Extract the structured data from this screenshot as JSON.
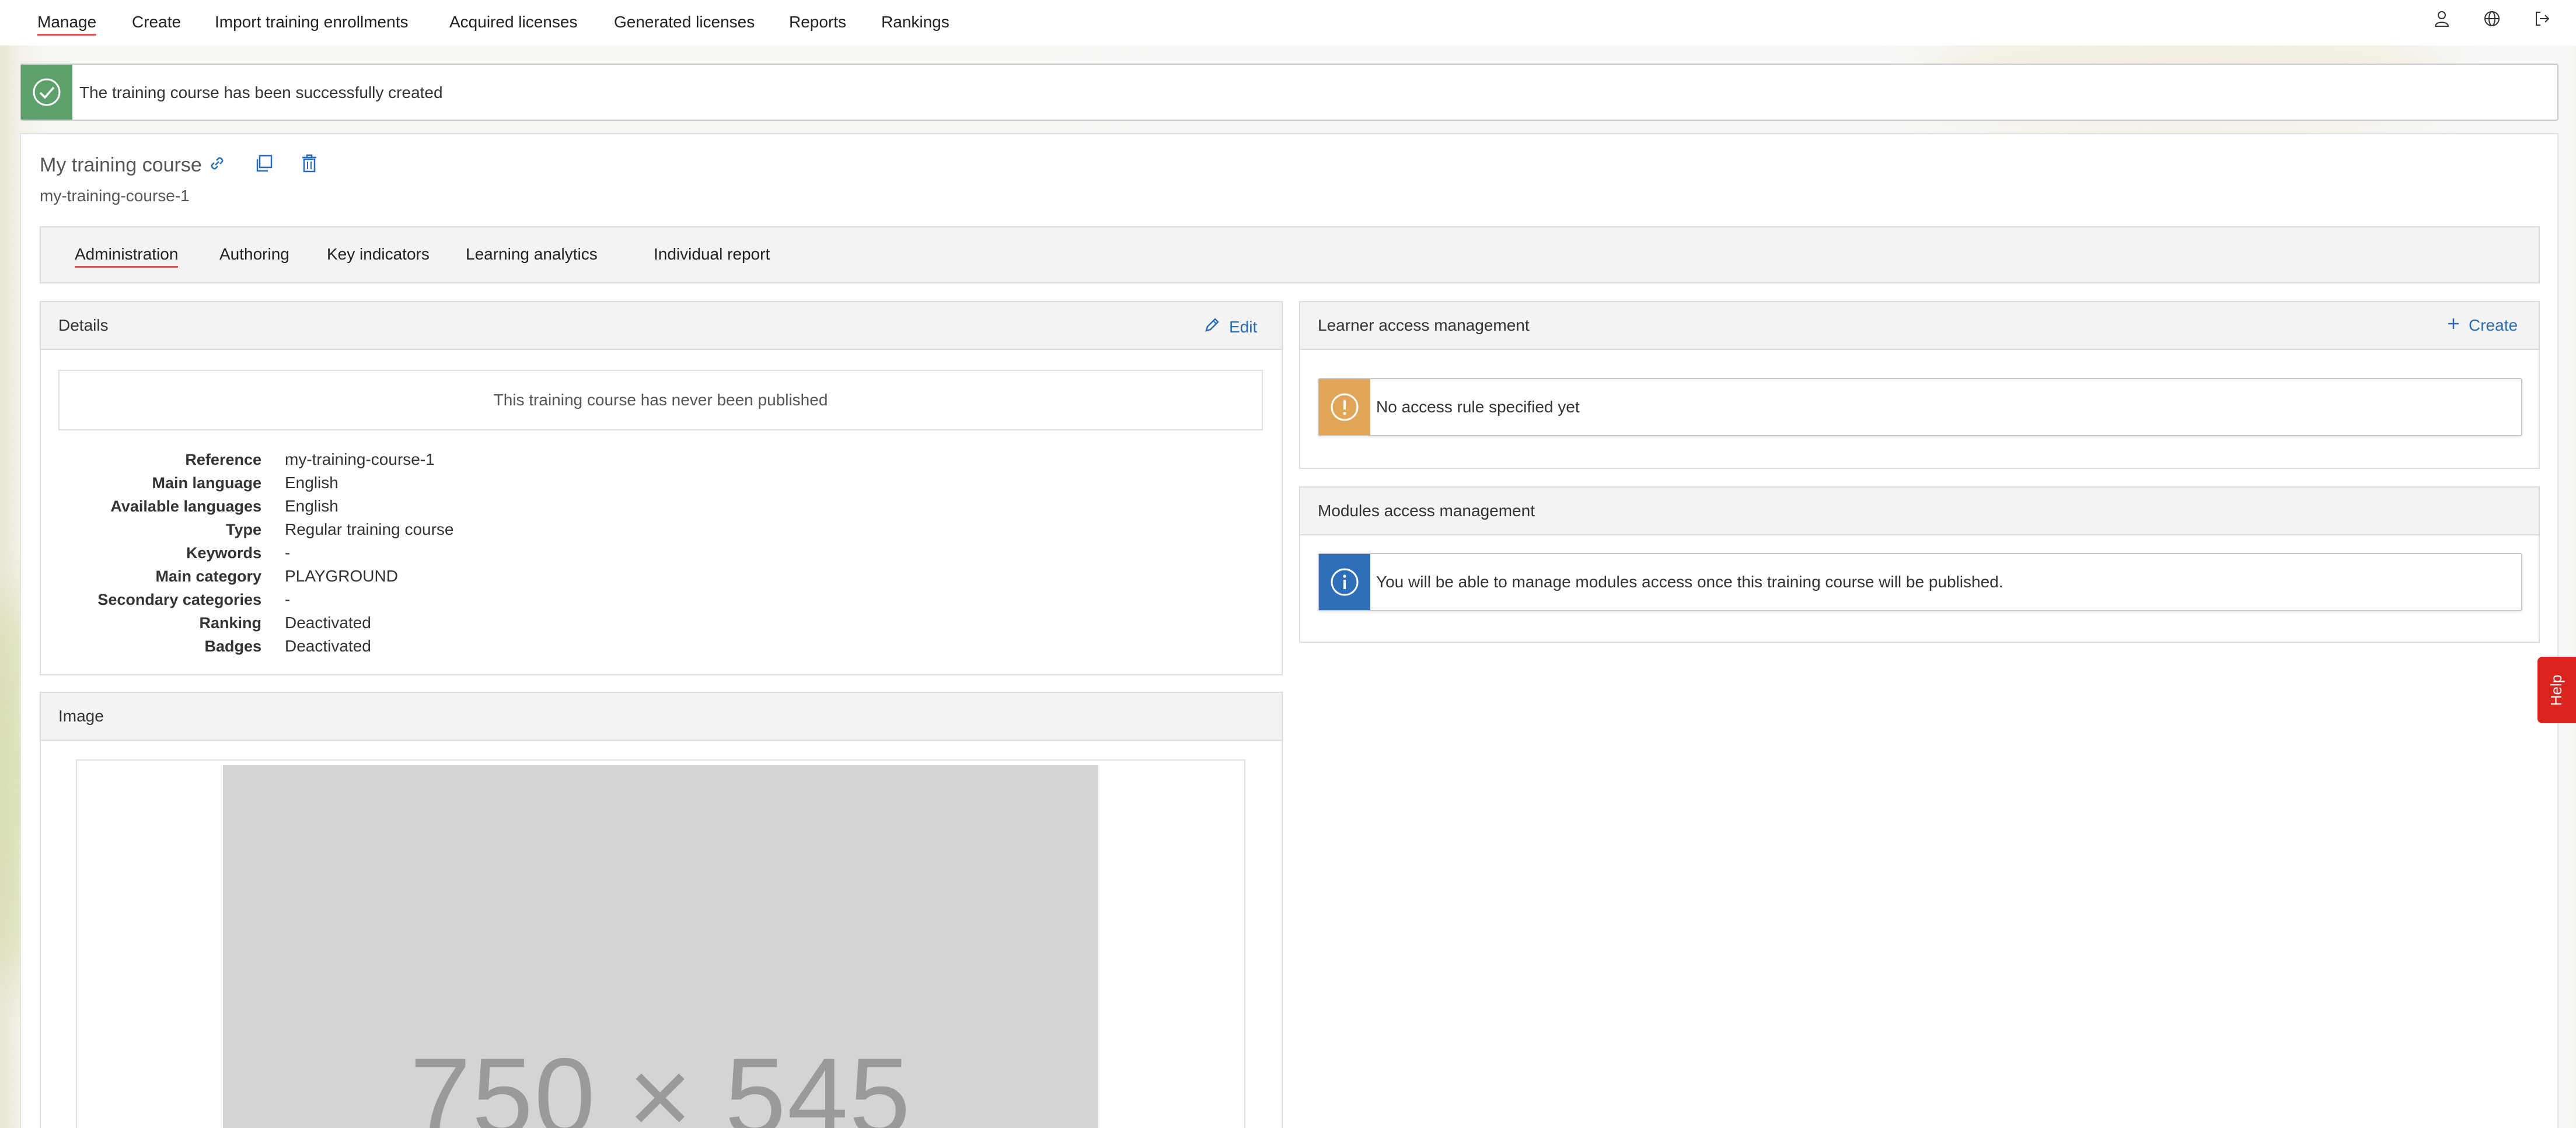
{
  "nav": {
    "items": [
      "Manage",
      "Create",
      "Import training enrollments",
      "Acquired licenses",
      "Generated licenses",
      "Reports",
      "Rankings"
    ]
  },
  "alert": {
    "text": "The training course has been successfully created"
  },
  "course": {
    "title": "My training course",
    "slug": "my-training-course-1"
  },
  "tabs": [
    "Administration",
    "Authoring",
    "Key indicators",
    "Learning analytics",
    "Individual report"
  ],
  "details": {
    "title": "Details",
    "edit_label": "Edit",
    "not_published": "This training course has never been published",
    "rows": [
      {
        "label": "Reference",
        "value": "my-training-course-1"
      },
      {
        "label": "Main language",
        "value": "English"
      },
      {
        "label": "Available languages",
        "value": "English"
      },
      {
        "label": "Type",
        "value": "Regular training course"
      },
      {
        "label": "Keywords",
        "value": "-"
      },
      {
        "label": "Main category",
        "value": "PLAYGROUND"
      },
      {
        "label": "Secondary categories",
        "value": "-"
      },
      {
        "label": "Ranking",
        "value": "Deactivated"
      },
      {
        "label": "Badges",
        "value": "Deactivated"
      }
    ]
  },
  "learner_access": {
    "title": "Learner access management",
    "create_label": "Create",
    "message": "No access rule specified yet"
  },
  "modules_access": {
    "title": "Modules access management",
    "message": "You will be able to manage modules access once this training course will be published."
  },
  "image_panel": {
    "title": "Image",
    "placeholder": "750 × 545"
  },
  "help": {
    "label": "Help"
  },
  "colors": {
    "accent": "#2a6cb3",
    "success": "#5ea06b",
    "warning": "#e0a657",
    "info": "#2f6fba",
    "danger": "#d9231d"
  }
}
